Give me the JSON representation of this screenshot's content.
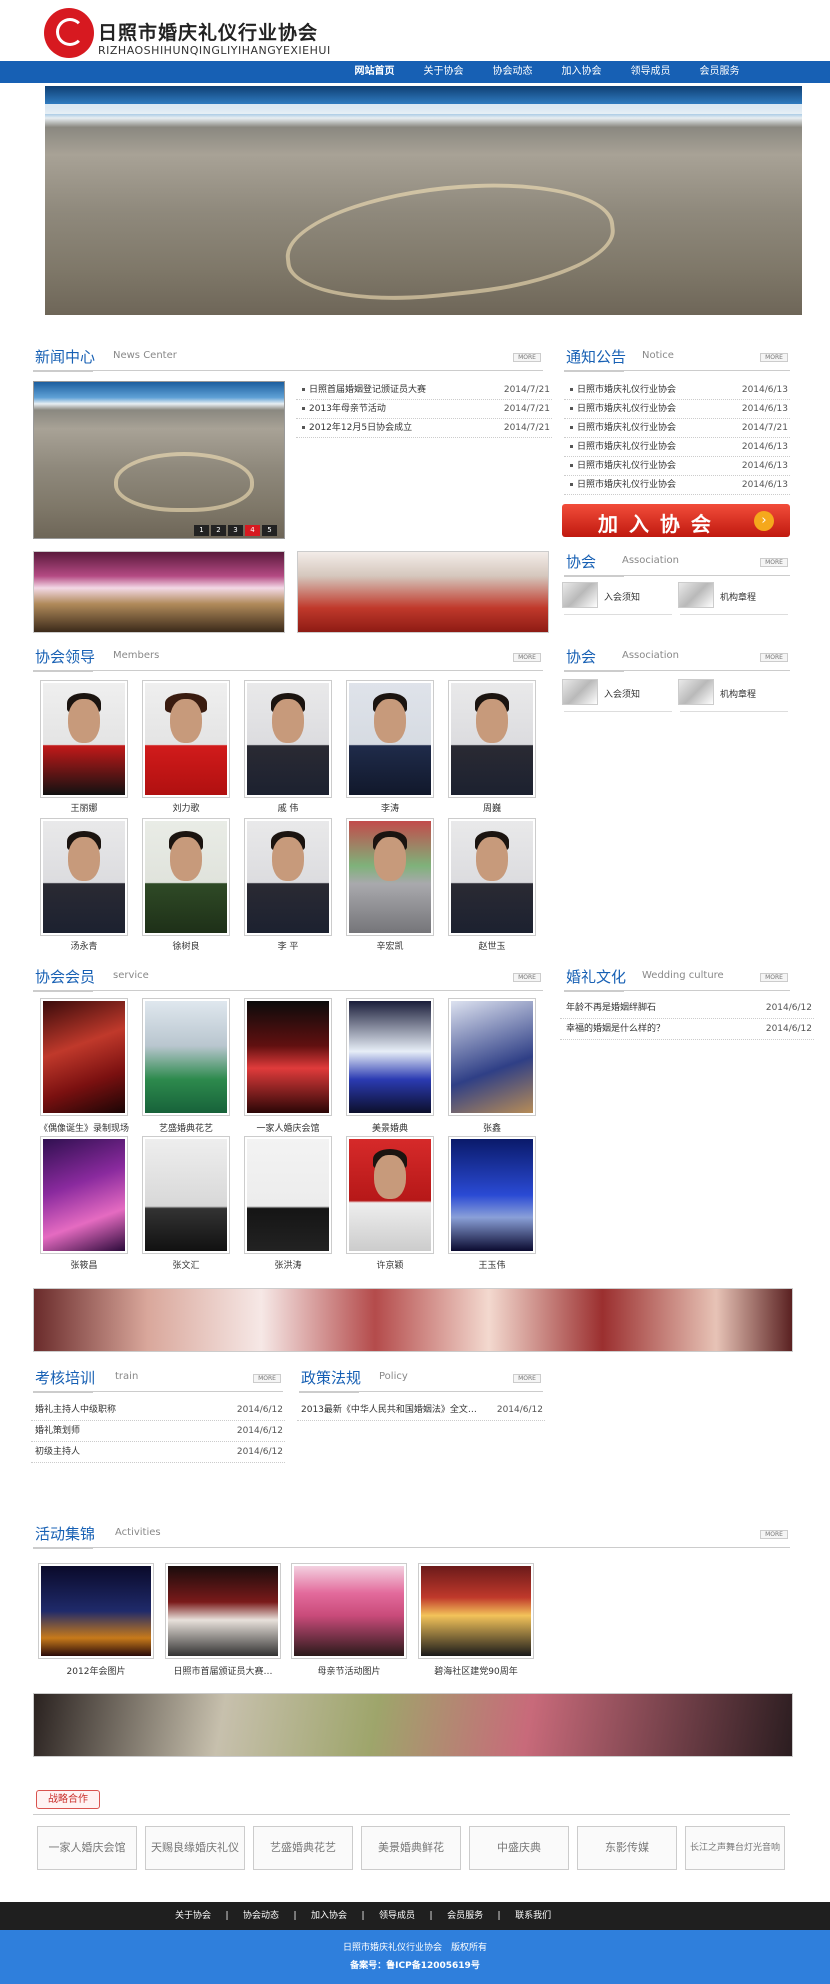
{
  "header": {
    "logo_cn": "日照市婚庆礼仪行业协会",
    "logo_en": "RIZHAOSHIHUNQINGLIYIHANGYEXIEHUI"
  },
  "nav": [
    {
      "label": "网站首页"
    },
    {
      "label": "关于协会"
    },
    {
      "label": "协会动态"
    },
    {
      "label": "加入协会"
    },
    {
      "label": "领导成员"
    },
    {
      "label": "会员服务"
    }
  ],
  "more": "MORE",
  "news": {
    "title": "新闻中心",
    "en": "News Center",
    "pager": [
      "1",
      "2",
      "3",
      "4",
      "5"
    ],
    "items": [
      {
        "text": "日照首届婚姻登记颁证员大赛",
        "date": "2014/7/21"
      },
      {
        "text": "2013年母亲节活动",
        "date": "2014/7/21"
      },
      {
        "text": "2012年12月5日协会成立",
        "date": "2014/7/21"
      }
    ]
  },
  "notice": {
    "title": "通知公告",
    "en": "Notice",
    "items": [
      {
        "text": "日照市婚庆礼仪行业协会",
        "date": "2014/6/13"
      },
      {
        "text": "日照市婚庆礼仪行业协会",
        "date": "2014/6/13"
      },
      {
        "text": "日照市婚庆礼仪行业协会",
        "date": "2014/7/21"
      },
      {
        "text": "日照市婚庆礼仪行业协会",
        "date": "2014/6/13"
      },
      {
        "text": "日照市婚庆礼仪行业协会",
        "date": "2014/6/13"
      },
      {
        "text": "日照市婚庆礼仪行业协会",
        "date": "2014/6/13"
      }
    ]
  },
  "join_banner": "加 入 协 会",
  "assoc1": {
    "title": "协会",
    "en": "Association",
    "links": [
      "入会须知",
      "机构章程"
    ]
  },
  "assoc2": {
    "title": "协会",
    "en": "Association",
    "links": [
      "入会须知",
      "机构章程"
    ]
  },
  "leaders": {
    "title": "协会领导",
    "en": "Members",
    "people": [
      "王丽娜",
      "刘力歌",
      "戚 伟",
      "李涛",
      "周巍",
      "汤永青",
      "徐树良",
      "李 平",
      "辛宏凯",
      "赵世玉"
    ]
  },
  "members": {
    "title": "协会会员",
    "en": "service",
    "items": [
      "《偶像诞生》录制现场",
      "艺盛婚典花艺",
      "一家人婚庆会馆",
      "美景婚典",
      "张鑫",
      "张筱昌",
      "张文汇",
      "张洪涛",
      "许京颖",
      "王玉伟"
    ]
  },
  "culture": {
    "title": "婚礼文化",
    "en": "Wedding culture",
    "items": [
      {
        "text": "年龄不再是婚姻绊脚石",
        "date": "2014/6/12"
      },
      {
        "text": "幸福的婚姻是什么样的？",
        "date": "2014/6/12"
      }
    ]
  },
  "train": {
    "title": "考核培训",
    "en": "train",
    "items": [
      {
        "text": "婚礼主持人中级职称",
        "date": "2014/6/12"
      },
      {
        "text": "婚礼策划师",
        "date": "2014/6/12"
      },
      {
        "text": "初级主持人",
        "date": "2014/6/12"
      }
    ]
  },
  "policy": {
    "title": "政策法规",
    "en": "Policy",
    "items": [
      {
        "text": "2013最新《中华人民共和国婚姻法》全文…",
        "date": "2014/6/12"
      }
    ]
  },
  "activities": {
    "title": "活动集锦",
    "en": "Activities",
    "items": [
      "2012年会图片",
      "日照市首届颁证员大赛…",
      "母亲节活动图片",
      "碧海社区建党90周年"
    ]
  },
  "partners": {
    "tab": "战略合作",
    "items": [
      "一家人婚庆会馆",
      "天赐良缘婚庆礼仪",
      "艺盛婚典花艺",
      "美景婚典鲜花",
      "中盛庆典",
      "东影传媒",
      "长江之声舞台灯光音响"
    ]
  },
  "footer": {
    "nav": [
      "关于协会",
      "协会动态",
      "加入协会",
      "领导成员",
      "会员服务",
      "联系我们"
    ],
    "separator": "|",
    "copyright": "日照市婚庆礼仪行业协会　版权所有",
    "icp": "备案号：鲁ICP备12005619号"
  }
}
